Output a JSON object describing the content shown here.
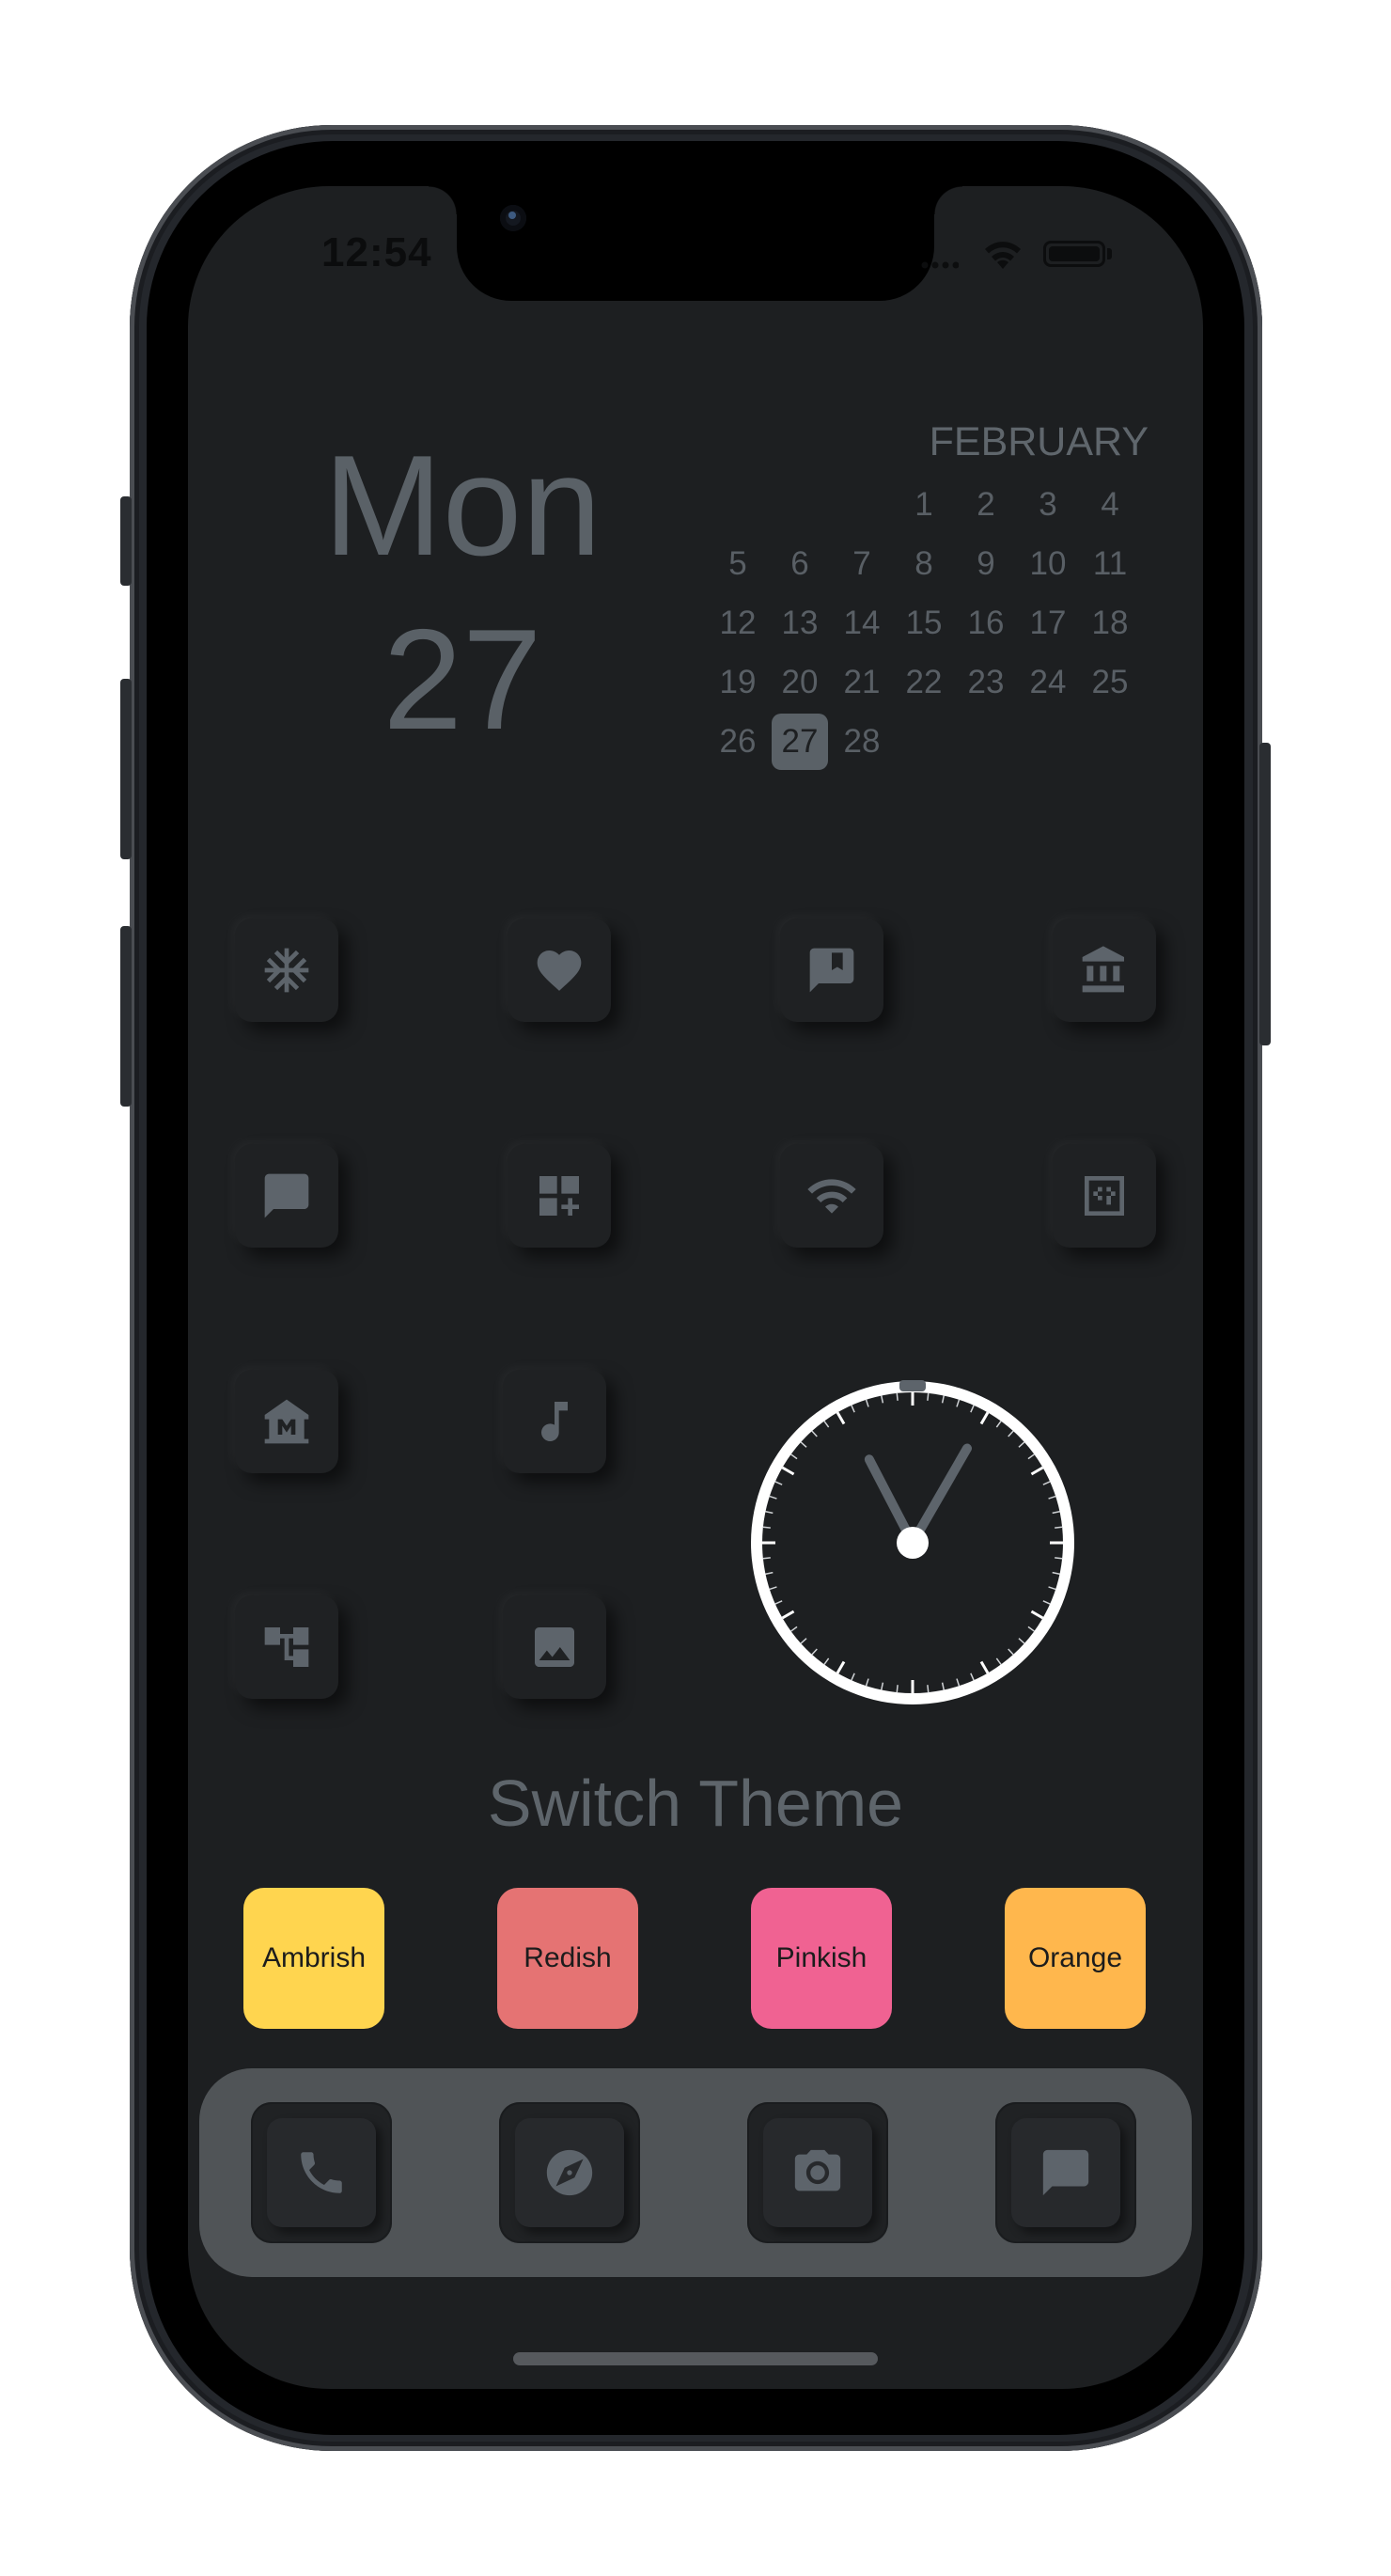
{
  "status_bar": {
    "time": "12:54"
  },
  "date_widget": {
    "day_name": "Mon",
    "day_number": "27"
  },
  "calendar": {
    "month": "FEBRUARY",
    "weeks": [
      [
        "",
        "",
        "",
        "1",
        "2",
        "3",
        "4"
      ],
      [
        "5",
        "6",
        "7",
        "8",
        "9",
        "10",
        "11"
      ],
      [
        "12",
        "13",
        "14",
        "15",
        "16",
        "17",
        "18"
      ],
      [
        "19",
        "20",
        "21",
        "22",
        "23",
        "24",
        "25"
      ],
      [
        "26",
        "27",
        "28",
        "",
        "",
        "",
        ""
      ]
    ],
    "today": "27"
  },
  "apps": [
    {
      "icon": "snowflake-icon"
    },
    {
      "icon": "heart-icon"
    },
    {
      "icon": "bookmark-message-icon"
    },
    {
      "icon": "bank-icon"
    },
    {
      "icon": "chat-icon"
    },
    {
      "icon": "dashboard-add-icon"
    },
    {
      "icon": "wifi-icon"
    },
    {
      "icon": "grid-dots-icon"
    },
    {
      "icon": "museum-icon"
    },
    {
      "icon": "music-note-icon"
    },
    {
      "icon": "tree-structure-icon"
    },
    {
      "icon": "image-icon"
    }
  ],
  "clock": {
    "hour": 11,
    "minute": 5
  },
  "theme_switcher": {
    "title": "Switch Theme",
    "themes": [
      {
        "label": "Ambrish",
        "color": "#ffd54f"
      },
      {
        "label": "Redish",
        "color": "#e57373"
      },
      {
        "label": "Pinkish",
        "color": "#f06292"
      },
      {
        "label": "Orange",
        "color": "#ffb74d"
      }
    ]
  },
  "dock": [
    {
      "icon": "phone-icon"
    },
    {
      "icon": "compass-icon"
    },
    {
      "icon": "camera-icon"
    },
    {
      "icon": "message-icon"
    }
  ]
}
